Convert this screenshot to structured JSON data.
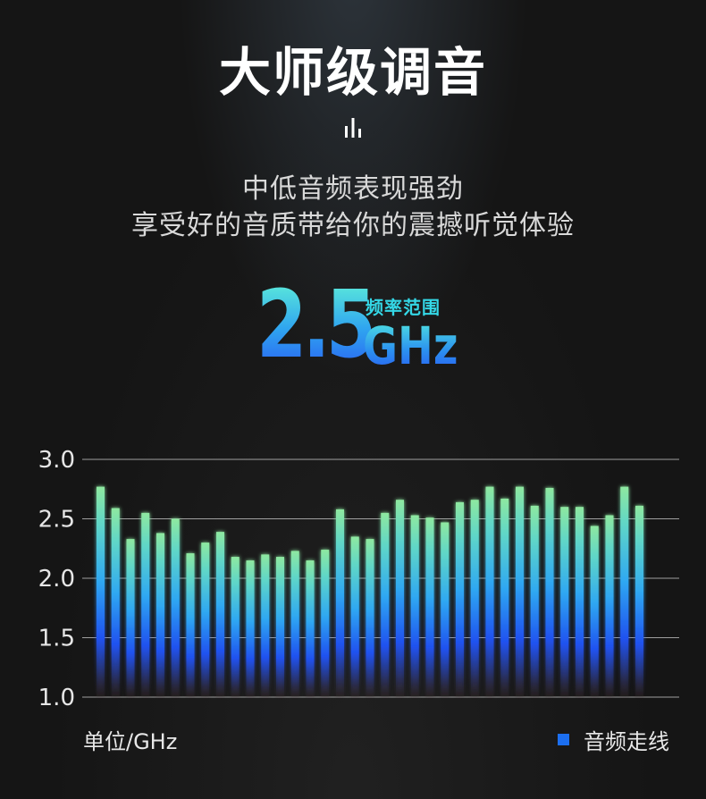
{
  "title": "大师级调音",
  "subtitle_line1": "中低音频表现强劲",
  "subtitle_line2": "享受好的音质带给你的震撼听觉体验",
  "spec": {
    "value": "2.5",
    "label": "频率范围",
    "unit": "GHz"
  },
  "unit_note": "单位/GHz",
  "colors": {
    "bar_top": "#7ee0a0",
    "bar_mid": "#2fb6f0",
    "bar_low": "#1f5ef0",
    "legend": "#1c6ff0",
    "gridline": "#b8b8b8"
  },
  "chart_data": {
    "type": "bar",
    "values": [
      2.77,
      2.59,
      2.33,
      2.55,
      2.38,
      2.5,
      2.21,
      2.3,
      2.39,
      2.18,
      2.15,
      2.2,
      2.18,
      2.23,
      2.15,
      2.24,
      2.58,
      2.35,
      2.33,
      2.55,
      2.66,
      2.53,
      2.51,
      2.47,
      2.64,
      2.66,
      2.77,
      2.67,
      2.77,
      2.61,
      2.76,
      2.6,
      2.6,
      2.44,
      2.53,
      2.77,
      2.61
    ],
    "yticks": [
      "3.0",
      "2.5",
      "2.0",
      "1.5",
      "1.0"
    ],
    "ylim": [
      1.0,
      3.0
    ],
    "legend": [
      {
        "name": "音频走线",
        "color": "#1c6ff0"
      }
    ],
    "grid": true
  }
}
